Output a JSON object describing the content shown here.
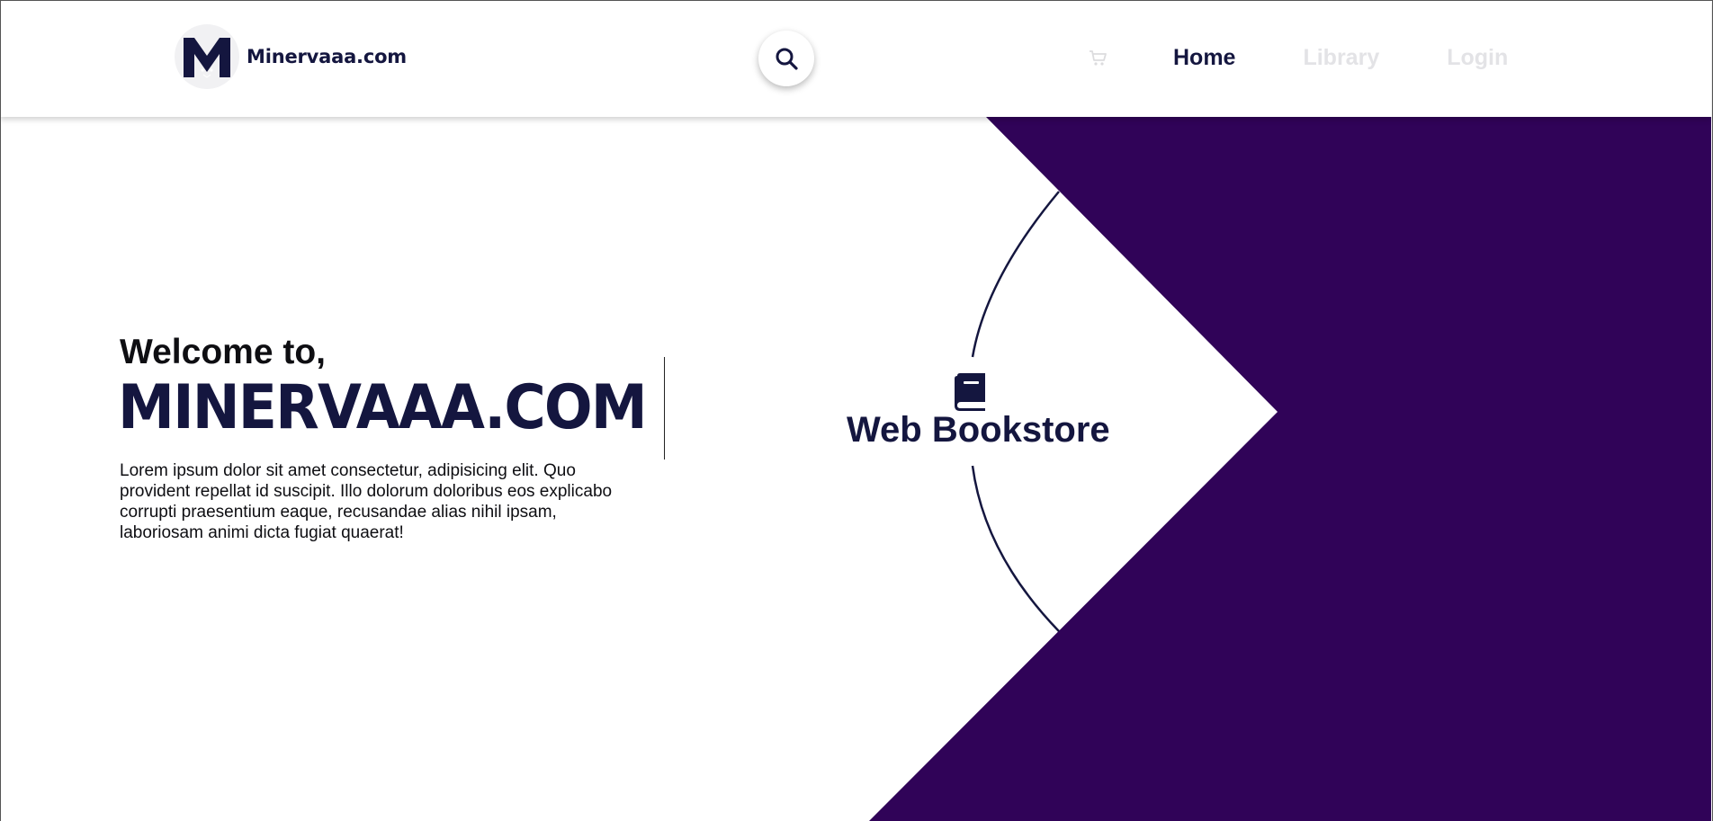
{
  "header": {
    "logo_text": "Minervaaa.com",
    "nav": {
      "home": "Home",
      "library": "Library",
      "login": "Login"
    }
  },
  "hero": {
    "welcome": "Welcome to,",
    "brand": "MINERVAAA.COM",
    "description": "Lorem ipsum dolor sit amet consectetur, adipisicing elit. Quo provident repellat id suscipit. Illo dolorum doloribus eos explicabo corrupti praesentium eaque, recusandae alias nihil ipsam, laboriosam animi dicta fugiat quaerat!"
  },
  "emblem": {
    "label": "Web Bookstore"
  },
  "icons": {
    "logo": "minerva-m-logo",
    "search": "search-icon",
    "cart": "cart-icon",
    "book": "book-icon"
  },
  "colors": {
    "brand_navy": "#14163f",
    "accent_purple": "#300358",
    "muted_nav": "#e3e3e6"
  }
}
